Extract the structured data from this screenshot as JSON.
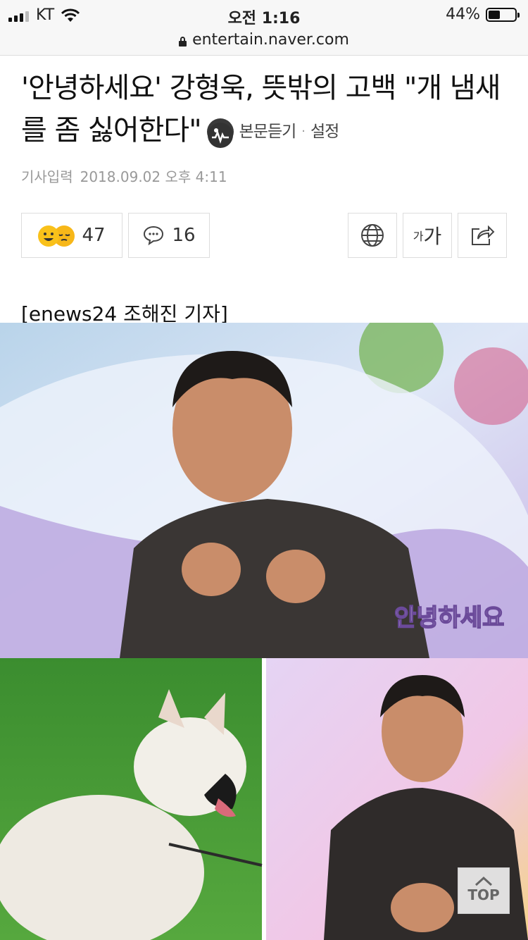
{
  "status": {
    "carrier": "KT",
    "time": "오전 1:16",
    "battery_text": "44%",
    "battery_level": 0.44
  },
  "url": {
    "domain": "entertain.naver.com"
  },
  "article": {
    "title": "'안녕하세요' 강형욱, 뜻밖의 고백 \"개 냄새를 좀 싫어한다\"",
    "listen_label": "본문듣기",
    "settings_label": "설정",
    "date_label": "기사입력",
    "timestamp": "2018.09.02 오후 4:11",
    "byline": "[enews24 조해진 기자]"
  },
  "toolbar": {
    "reaction_count": "47",
    "comment_count": "16",
    "font_small": "가",
    "font_large": "가"
  },
  "photo_logo": "안녕하세요",
  "top_button": "TOP",
  "icons": [
    "signal-icon",
    "wifi-icon",
    "battery-icon",
    "lock-icon",
    "listen-icon",
    "emoji-smile-icon",
    "emoji-sleepy-icon",
    "comment-icon",
    "globe-icon",
    "share-icon",
    "chevron-up-icon"
  ],
  "colors": {
    "emoji": "#f9c11a",
    "border": "#dddddd",
    "date": "#999999"
  }
}
